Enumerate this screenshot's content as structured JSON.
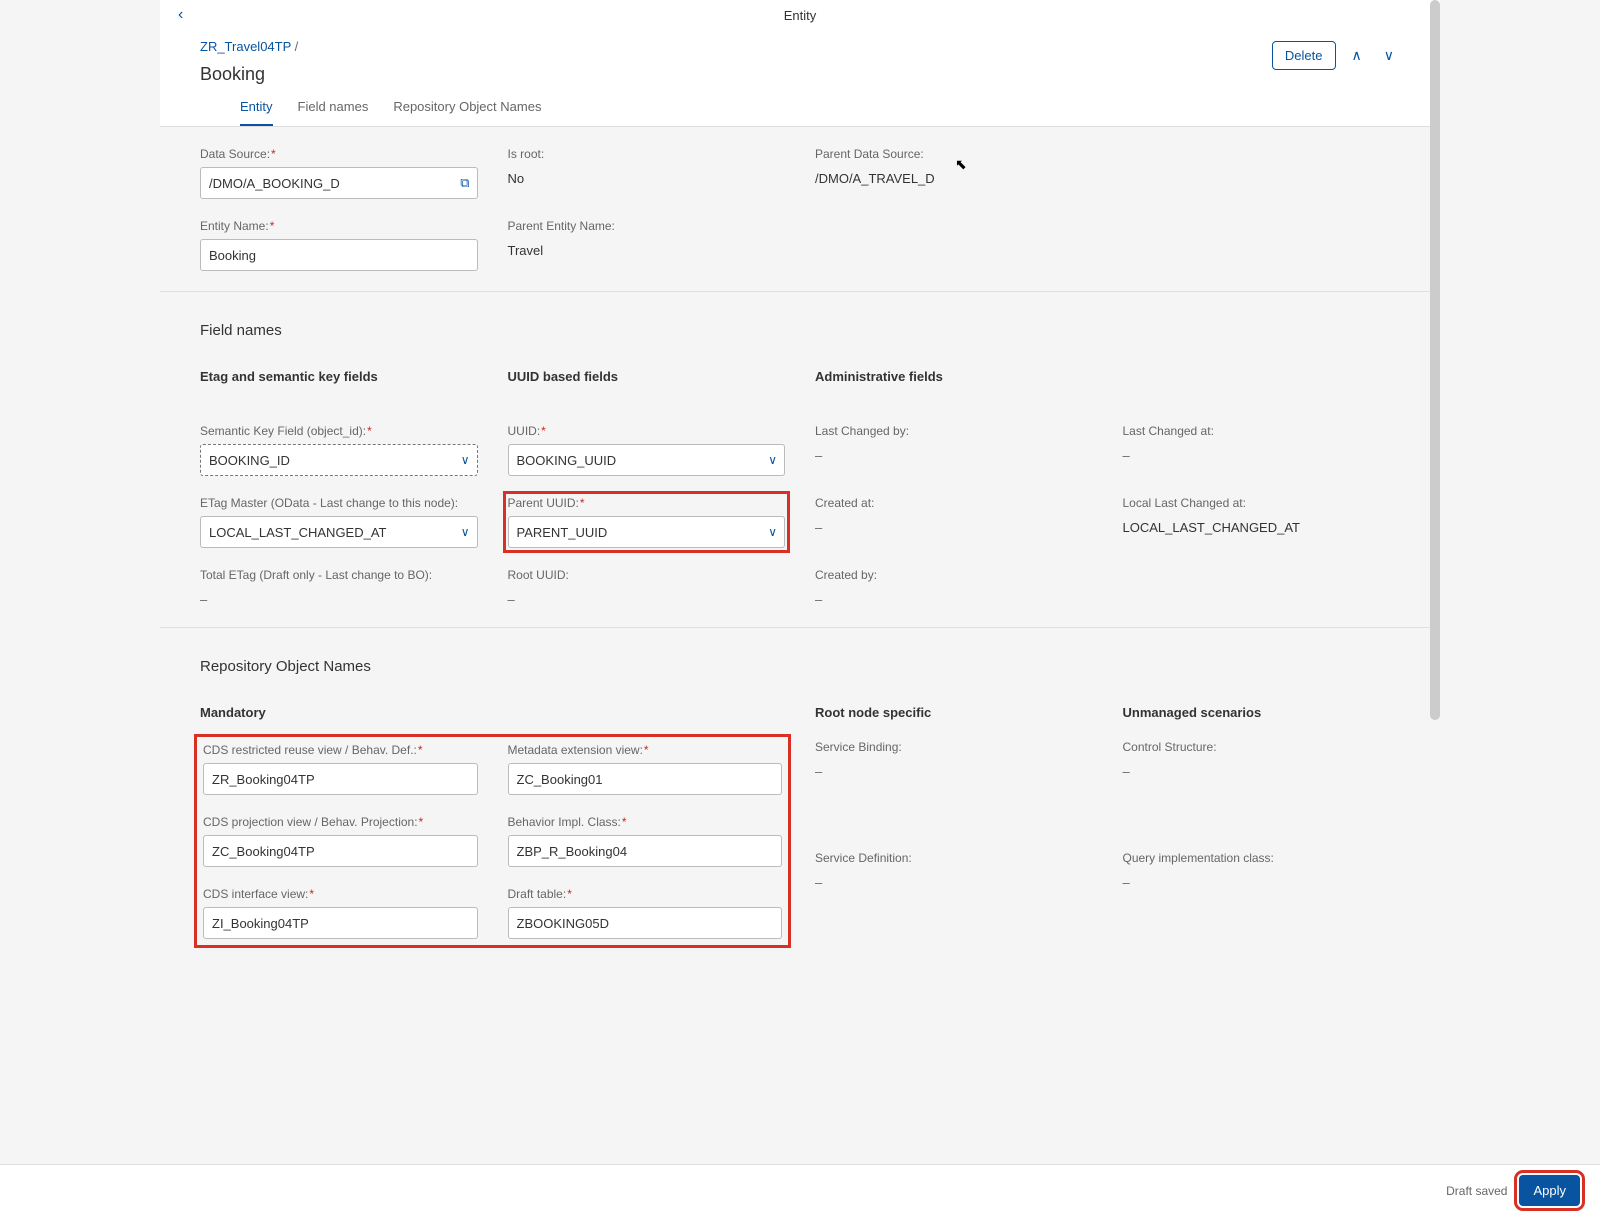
{
  "header": {
    "title": "Entity",
    "breadcrumb": "ZR_Travel04TP",
    "breadcrumb_sep": "/",
    "page_title": "Booking",
    "delete_label": "Delete"
  },
  "tabs": [
    {
      "label": "Entity"
    },
    {
      "label": "Field names"
    },
    {
      "label": "Repository Object Names"
    }
  ],
  "entity": {
    "data_source_label": "Data Source:",
    "data_source_value": "/DMO/A_BOOKING_D",
    "is_root_label": "Is root:",
    "is_root_value": "No",
    "parent_ds_label": "Parent Data Source:",
    "parent_ds_value": "/DMO/A_TRAVEL_D",
    "entity_name_label": "Entity Name:",
    "entity_name_value": "Booking",
    "parent_entity_label": "Parent Entity Name:",
    "parent_entity_value": "Travel"
  },
  "field_names": {
    "section_title": "Field names",
    "etag": {
      "title": "Etag and semantic key fields",
      "semantic_key_label": "Semantic Key Field (object_id):",
      "semantic_key_value": "BOOKING_ID",
      "etag_master_label": "ETag Master (OData - Last change to this node):",
      "etag_master_value": "LOCAL_LAST_CHANGED_AT",
      "total_etag_label": "Total ETag (Draft only - Last change to BO):",
      "total_etag_value": "–"
    },
    "uuid": {
      "title": "UUID based fields",
      "uuid_label": "UUID:",
      "uuid_value": "BOOKING_UUID",
      "parent_uuid_label": "Parent UUID:",
      "parent_uuid_value": "PARENT_UUID",
      "root_uuid_label": "Root UUID:",
      "root_uuid_value": "–"
    },
    "admin": {
      "title": "Administrative fields",
      "last_changed_by_label": "Last Changed by:",
      "last_changed_by_value": "–",
      "created_at_label": "Created at:",
      "created_at_value": "–",
      "created_by_label": "Created by:",
      "created_by_value": "–",
      "last_changed_at_label": "Last Changed at:",
      "last_changed_at_value": "–",
      "local_last_changed_at_label": "Local Last Changed at:",
      "local_last_changed_at_value": "LOCAL_LAST_CHANGED_AT"
    }
  },
  "repo": {
    "section_title": "Repository Object Names",
    "mandatory": {
      "title": "Mandatory",
      "cds_reuse_label": "CDS restricted reuse view / Behav. Def.:",
      "cds_reuse_value": "ZR_Booking04TP",
      "cds_proj_label": "CDS projection view / Behav. Projection:",
      "cds_proj_value": "ZC_Booking04TP",
      "cds_iface_label": "CDS interface view:",
      "cds_iface_value": "ZI_Booking04TP",
      "meta_ext_label": "Metadata extension view:",
      "meta_ext_value": "ZC_Booking01",
      "behav_class_label": "Behavior Impl. Class:",
      "behav_class_value": "ZBP_R_Booking04",
      "draft_table_label": "Draft table:",
      "draft_table_value": "ZBOOKING05D"
    },
    "root_specific": {
      "title": "Root node specific",
      "service_binding_label": "Service Binding:",
      "service_binding_value": "–",
      "service_def_label": "Service Definition:",
      "service_def_value": "–"
    },
    "unmanaged": {
      "title": "Unmanaged scenarios",
      "control_struct_label": "Control Structure:",
      "control_struct_value": "–",
      "query_impl_label": "Query implementation class:",
      "query_impl_value": "–"
    }
  },
  "footer": {
    "saved_text": "Draft saved",
    "apply_label": "Apply"
  }
}
